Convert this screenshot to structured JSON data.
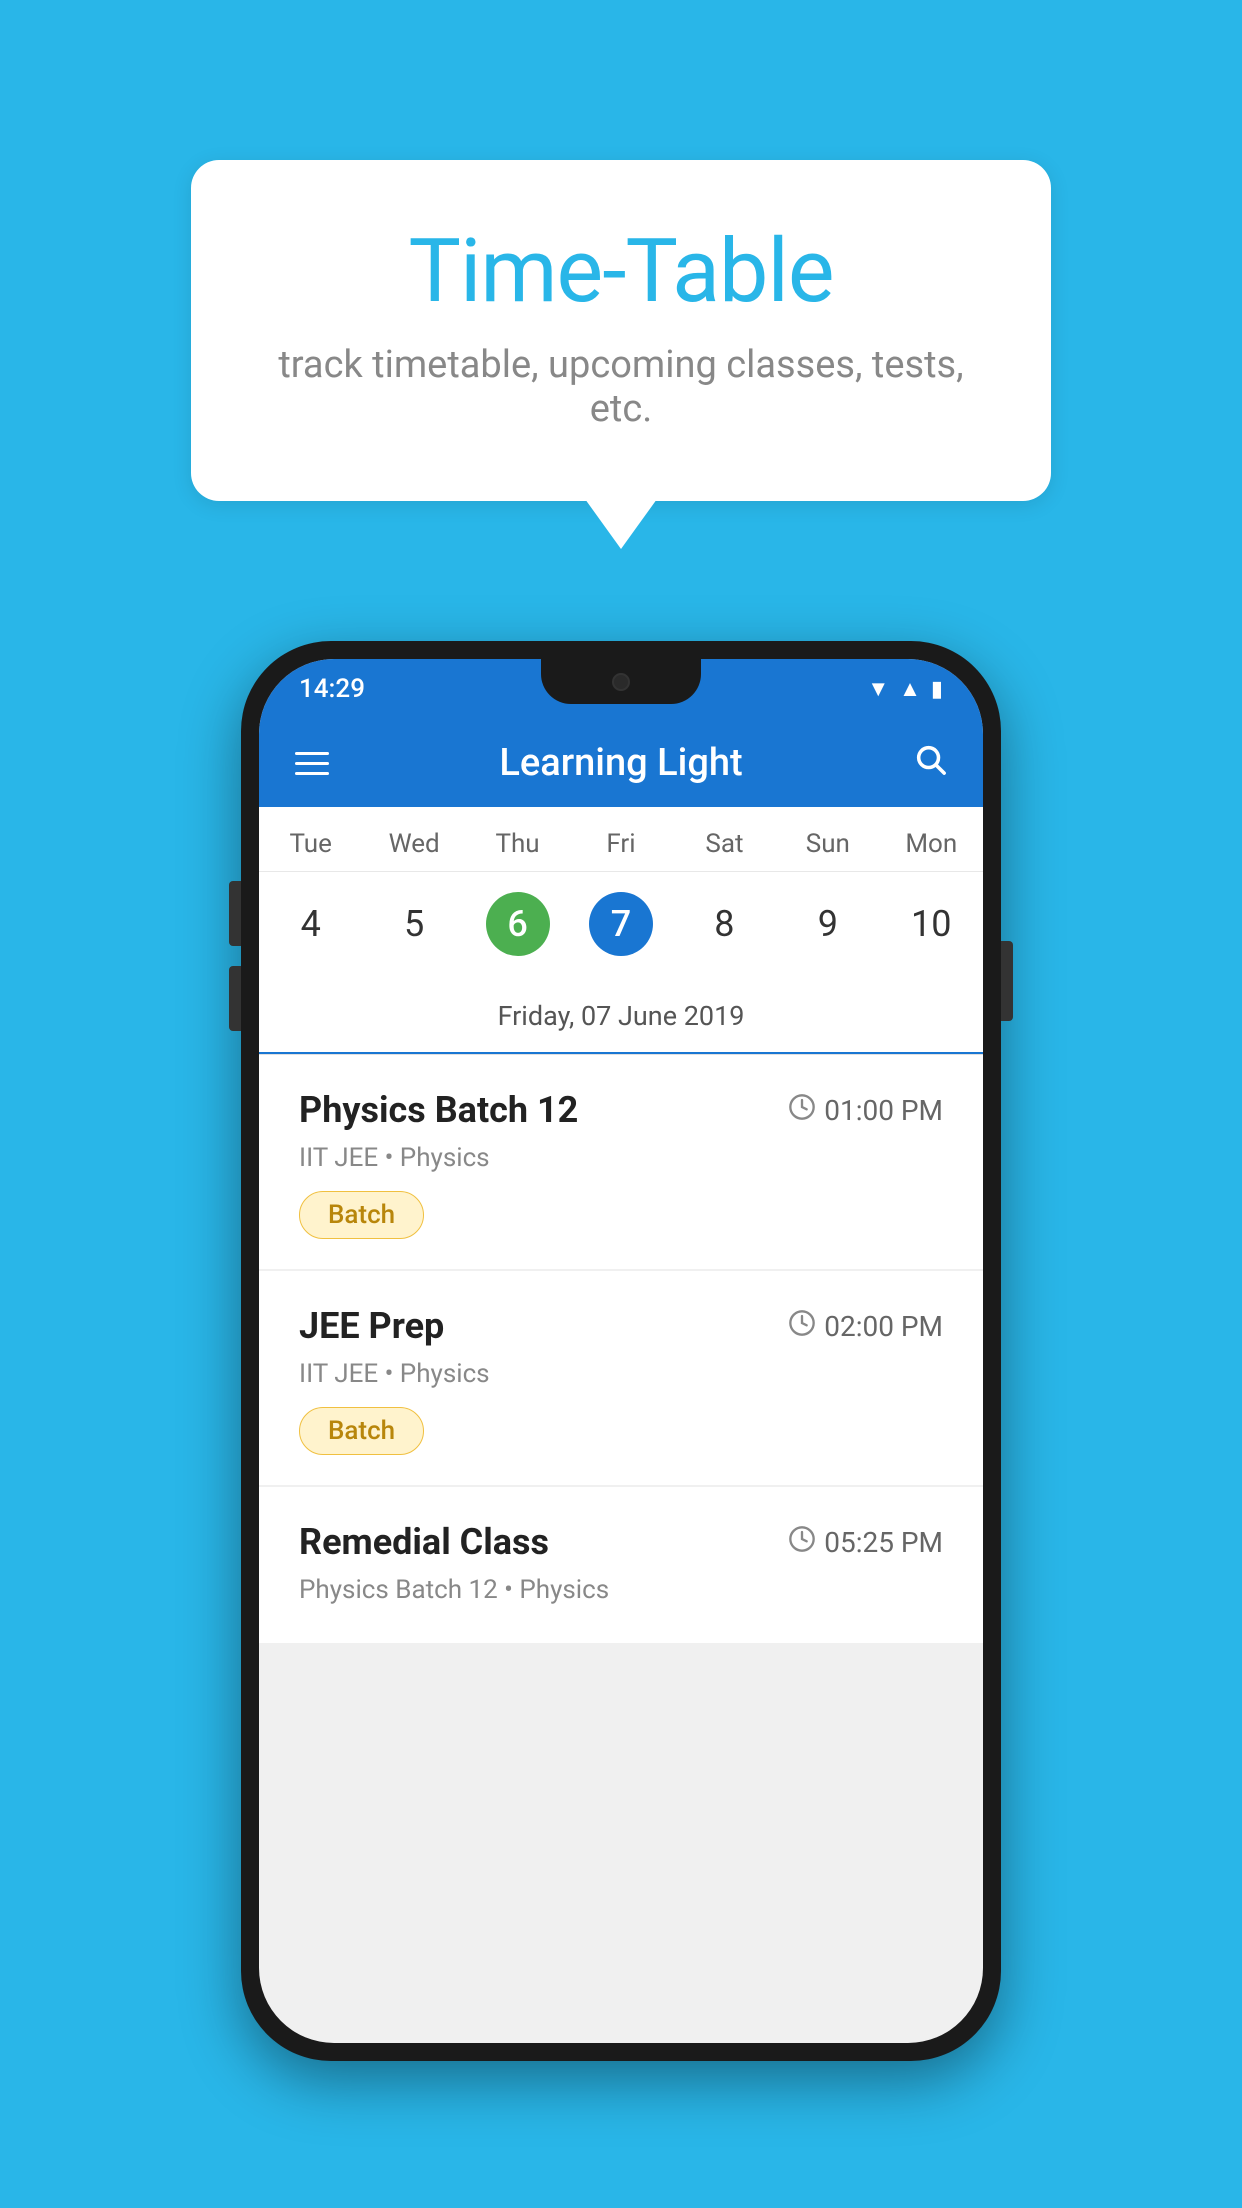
{
  "background_color": "#29b6e8",
  "speech_bubble": {
    "title": "Time-Table",
    "subtitle": "track timetable, upcoming classes, tests, etc."
  },
  "phone": {
    "status_bar": {
      "time": "14:29"
    },
    "app_bar": {
      "title": "Learning Light"
    },
    "calendar": {
      "days": [
        "Tue",
        "Wed",
        "Thu",
        "Fri",
        "Sat",
        "Sun",
        "Mon"
      ],
      "dates": [
        "4",
        "5",
        "6",
        "7",
        "8",
        "9",
        "10"
      ],
      "today_index": 2,
      "selected_index": 3,
      "selected_date_label": "Friday, 07 June 2019"
    },
    "schedule": [
      {
        "title": "Physics Batch 12",
        "time": "01:00 PM",
        "subtitle": "IIT JEE • Physics",
        "badge": "Batch"
      },
      {
        "title": "JEE Prep",
        "time": "02:00 PM",
        "subtitle": "IIT JEE • Physics",
        "badge": "Batch"
      },
      {
        "title": "Remedial Class",
        "time": "05:25 PM",
        "subtitle": "Physics Batch 12 • Physics",
        "badge": null
      }
    ]
  }
}
